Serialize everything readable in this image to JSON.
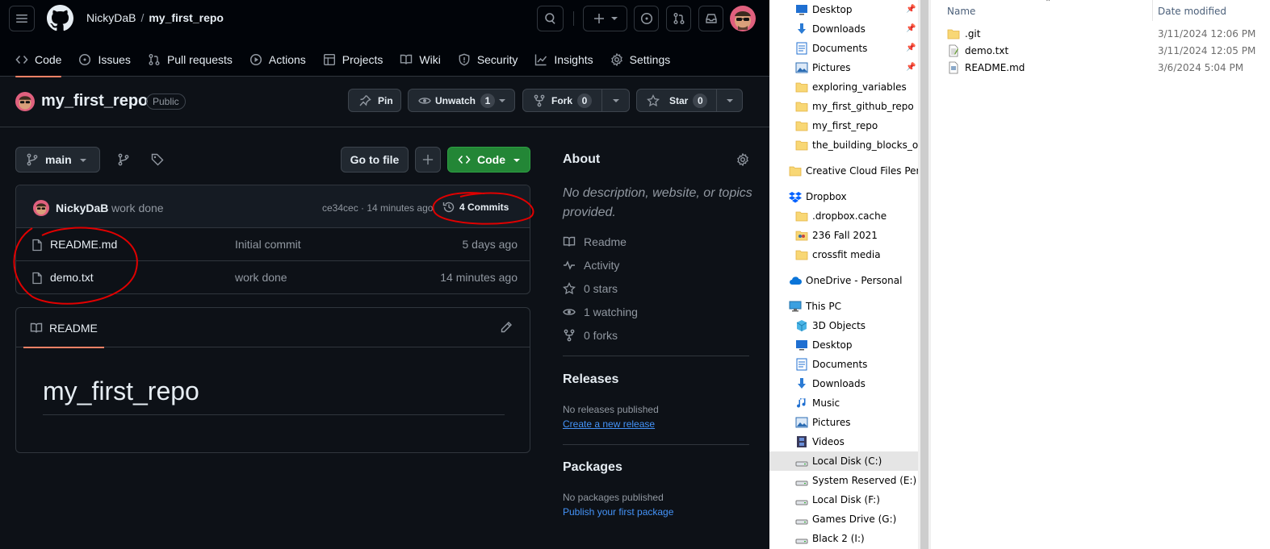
{
  "github": {
    "header": {
      "owner": "NickyDaB",
      "separator": "/",
      "repo": "my_first_repo"
    },
    "tabs": [
      {
        "label": "Code",
        "icon": "code-icon"
      },
      {
        "label": "Issues",
        "icon": "issue-opened-icon"
      },
      {
        "label": "Pull requests",
        "icon": "git-pull-request-icon"
      },
      {
        "label": "Actions",
        "icon": "play-icon"
      },
      {
        "label": "Projects",
        "icon": "table-icon"
      },
      {
        "label": "Wiki",
        "icon": "book-icon"
      },
      {
        "label": "Security",
        "icon": "shield-icon"
      },
      {
        "label": "Insights",
        "icon": "graph-icon"
      },
      {
        "label": "Settings",
        "icon": "gear-icon"
      }
    ],
    "repo_title": {
      "name": "my_first_repo",
      "visibility": "Public",
      "pin_label": "Pin",
      "watch_label": "Unwatch",
      "watch_count": "1",
      "fork_label": "Fork",
      "fork_count": "0",
      "star_label": "Star",
      "star_count": "0"
    },
    "branch": {
      "name": "main",
      "go_to_file": "Go to file",
      "add_file": "+",
      "code": "Code"
    },
    "commit": {
      "author": "NickyDaB",
      "message": "work done",
      "meta": "ce34cec · 14 minutes ago",
      "commits_label": "4 Commits"
    },
    "files": [
      {
        "name": "README.md",
        "message": "Initial commit",
        "age": "5 days ago"
      },
      {
        "name": "demo.txt",
        "message": "work done",
        "age": "14 minutes ago"
      }
    ],
    "readme": {
      "tab": "README",
      "heading": "my_first_repo"
    },
    "about": {
      "title": "About",
      "description": "No description, website, or topics provided.",
      "items": [
        {
          "label": "Readme",
          "icon": "book-icon"
        },
        {
          "label": "Activity",
          "icon": "pulse-icon"
        },
        {
          "label": "0 stars",
          "icon": "star-icon"
        },
        {
          "label": "1 watching",
          "icon": "eye-icon"
        },
        {
          "label": "0 forks",
          "icon": "repo-forked-icon"
        }
      ]
    },
    "releases": {
      "title": "Releases",
      "empty": "No releases published",
      "link": "Create a new release"
    },
    "packages": {
      "title": "Packages",
      "empty": "No packages published",
      "link": "Publish your first package"
    },
    "colors": {
      "background": "#0d1117",
      "header": "#010409",
      "primary_button": "#238636",
      "accent_underline": "#f78166",
      "link": "#4493f8",
      "annotation": "#e00000"
    }
  },
  "explorer": {
    "nav": [
      {
        "label": "Desktop",
        "icon": "desktop-icon",
        "pinned": true
      },
      {
        "label": "Downloads",
        "icon": "download-arrow-icon",
        "pinned": true
      },
      {
        "label": "Documents",
        "icon": "documents-icon",
        "pinned": true
      },
      {
        "label": "Pictures",
        "icon": "pictures-icon",
        "pinned": true
      },
      {
        "label": "exploring_variables",
        "icon": "folder-icon"
      },
      {
        "label": "my_first_github_repo",
        "icon": "folder-icon"
      },
      {
        "label": "my_first_repo",
        "icon": "folder-icon"
      },
      {
        "label": "the_building_blocks_of_p",
        "icon": "folder-icon"
      },
      {
        "label": "Creative Cloud Files Persor",
        "icon": "folder-icon"
      },
      {
        "label": "Dropbox",
        "icon": "dropbox-icon"
      },
      {
        "label": ".dropbox.cache",
        "icon": "folder-icon"
      },
      {
        "label": "236 Fall 2021",
        "icon": "folder-people-icon"
      },
      {
        "label": "crossfit media",
        "icon": "folder-icon"
      },
      {
        "label": "OneDrive - Personal",
        "icon": "onedrive-cloud-icon"
      },
      {
        "label": "This PC",
        "icon": "computer-icon"
      },
      {
        "label": "3D Objects",
        "icon": "cube-icon"
      },
      {
        "label": "Desktop",
        "icon": "desktop-icon"
      },
      {
        "label": "Documents",
        "icon": "documents-icon"
      },
      {
        "label": "Downloads",
        "icon": "download-arrow-icon"
      },
      {
        "label": "Music",
        "icon": "music-note-icon"
      },
      {
        "label": "Pictures",
        "icon": "pictures-icon"
      },
      {
        "label": "Videos",
        "icon": "film-icon"
      },
      {
        "label": "Local Disk (C:)",
        "icon": "drive-icon",
        "selected": true
      },
      {
        "label": "System Reserved (E:)",
        "icon": "drive-icon"
      },
      {
        "label": "Local Disk (F:)",
        "icon": "drive-icon"
      },
      {
        "label": "Games Drive (G:)",
        "icon": "drive-icon"
      },
      {
        "label": "Black 2 (I:)",
        "icon": "drive-icon"
      }
    ],
    "columns": {
      "name": "Name",
      "date": "Date modified"
    },
    "files": [
      {
        "name": ".git",
        "date": "3/11/2024 12:06 PM",
        "icon": "folder-icon"
      },
      {
        "name": "demo.txt",
        "date": "3/11/2024 12:05 PM",
        "icon": "text-file-icon"
      },
      {
        "name": "README.md",
        "date": "3/6/2024 5:04 PM",
        "icon": "file-icon"
      }
    ]
  }
}
